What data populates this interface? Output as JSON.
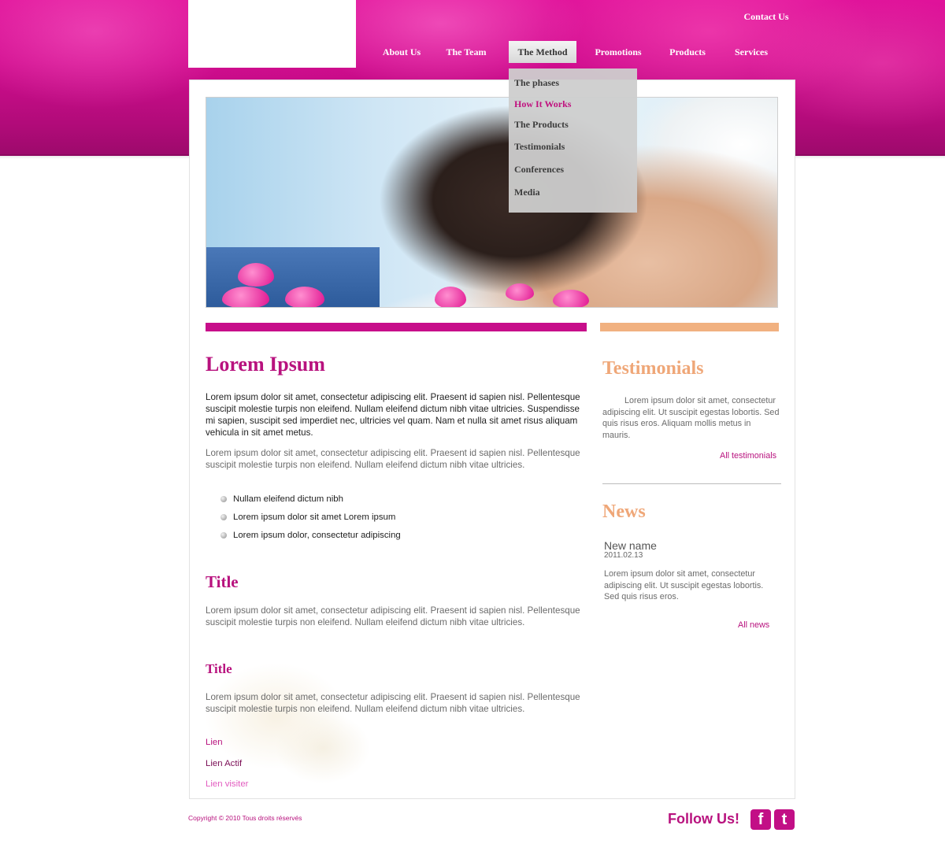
{
  "header": {
    "contact_label": "Contact Us"
  },
  "nav": {
    "items": [
      {
        "label": "About Us"
      },
      {
        "label": "The Team"
      },
      {
        "label": "The Method"
      },
      {
        "label": "Promotions"
      },
      {
        "label": "Products"
      },
      {
        "label": "Services"
      }
    ],
    "active": "The Method"
  },
  "dropdown": {
    "items": [
      {
        "label": "The phases"
      },
      {
        "label": "How It Works"
      },
      {
        "label": "The Products"
      },
      {
        "label": "Testimonials"
      },
      {
        "label": "Conferences"
      },
      {
        "label": "Media"
      }
    ],
    "hovered": "How It Works"
  },
  "main": {
    "heading": "Lorem Ipsum",
    "intro": "Lorem ipsum dolor sit amet, consectetur adipiscing elit. Praesent id sapien nisl. Pellentesque suscipit molestie turpis non eleifend. Nullam eleifend dictum nibh vitae ultricies. Suspendisse mi sapien, suscipit sed imperdiet nec, ultricies vel quam. Nam et nulla sit amet risus aliquam vehicula in sit amet metus.",
    "para1": "Lorem ipsum dolor sit amet, consectetur adipiscing elit. Praesent id sapien nisl. Pellentesque suscipit molestie turpis non eleifend. Nullam eleifend dictum nibh vitae ultricies.",
    "bullets": [
      "Nullam eleifend dictum nibh",
      "Lorem ipsum dolor sit amet Lorem ipsum",
      "Lorem ipsum dolor, consectetur adipiscing"
    ],
    "title2": "Title",
    "para2": "Lorem ipsum dolor sit amet, consectetur adipiscing elit. Praesent id sapien nisl. Pellentesque suscipit molestie turpis non eleifend. Nullam eleifend dictum nibh vitae ultricies.",
    "title3": "Title",
    "para3": "Lorem ipsum dolor sit amet, consectetur adipiscing elit. Praesent id sapien nisl. Pellentesque suscipit molestie turpis non eleifend. Nullam eleifend dictum nibh vitae ultricies.",
    "links": [
      {
        "label": "Lien",
        "color": "#b8127e"
      },
      {
        "label": "Lien Actif",
        "color": "#7a0d55"
      },
      {
        "label": "Lien visiter",
        "color": "#e25cbf"
      }
    ]
  },
  "sidebar": {
    "testimonials_heading": "Testimonials",
    "testimonials_text": "Lorem ipsum dolor sit amet, consectetur adipiscing elit.  Ut suscipit egestas lobortis. Sed quis risus eros. Aliquam mollis metus in mauris.",
    "all_testimonials": "All testimonials",
    "news_heading": "News",
    "news_name": "New name",
    "news_date": "2011.02.13",
    "news_text": "Lorem ipsum dolor sit amet, consectetur adipiscing elit. Ut suscipit egestas lobortis. Sed quis risus eros.",
    "all_news": "All news"
  },
  "footer": {
    "copyright": "Copyright © 2010  Tous droits réservés",
    "follow": "Follow Us!",
    "facebook_glyph": "f",
    "twitter_glyph": "t"
  },
  "colors": {
    "brand_magenta": "#c70e8a",
    "accent_peach": "#f1b180"
  }
}
